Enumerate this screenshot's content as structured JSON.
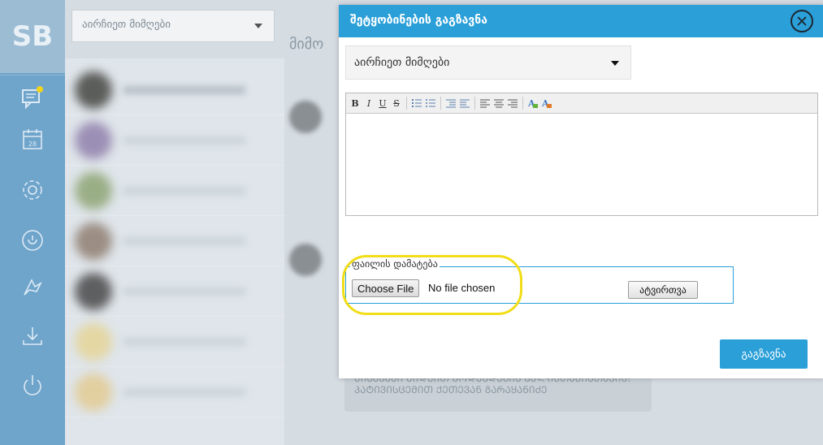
{
  "app": {
    "logo": "SB"
  },
  "rail": {
    "icons": [
      "chat-icon",
      "calendar-icon",
      "settings-gear-icon",
      "power-circle-icon",
      "signature-icon",
      "download-icon",
      "logout-power-icon"
    ],
    "calendar_day": "28",
    "notification_color": "#f2d41b"
  },
  "list": {
    "filter_select": {
      "selected": "აირჩიეთ მიმღები"
    }
  },
  "main": {
    "title_fragment": "მიმო",
    "bubble_text": "ᲛᲘᲡᲐᲡᲐᲛᲘ ᲛᲘᲓᲔᲘᲗ ᲛᲝᲓᲔᲡᲓᲔᲑᲘᲡ ᲒᲔᲚᲘᲡᲗᲐᲛᲘᲡᲗᲐᲕᲘᲡ! ᲞᲐᲢᲘᲕᲘᲡᲪᲔᲛᲘᲗ ᲥᲔᲗᲔᲕᲐᲜ ᲒᲐᲠᲐᲧᲐᲜᲘᲫᲔ"
  },
  "modal": {
    "title": "შეტყობინების გაგზავნა",
    "recipients": {
      "selected": "აირჩიეთ მიმღები"
    },
    "toolbar": {
      "bold": "B",
      "italic": "I",
      "underline": "U",
      "strike": "S"
    },
    "attachments": {
      "legend": "ფაილის დამატება",
      "choose_file": "Choose File",
      "status": "No file chosen",
      "attach_button": "ატვირთვა"
    },
    "send_button": "გაგზავნა"
  },
  "colors": {
    "accent": "#2a9fd8",
    "rail": "#6fa4cb",
    "highlight": "#f1dd18"
  }
}
